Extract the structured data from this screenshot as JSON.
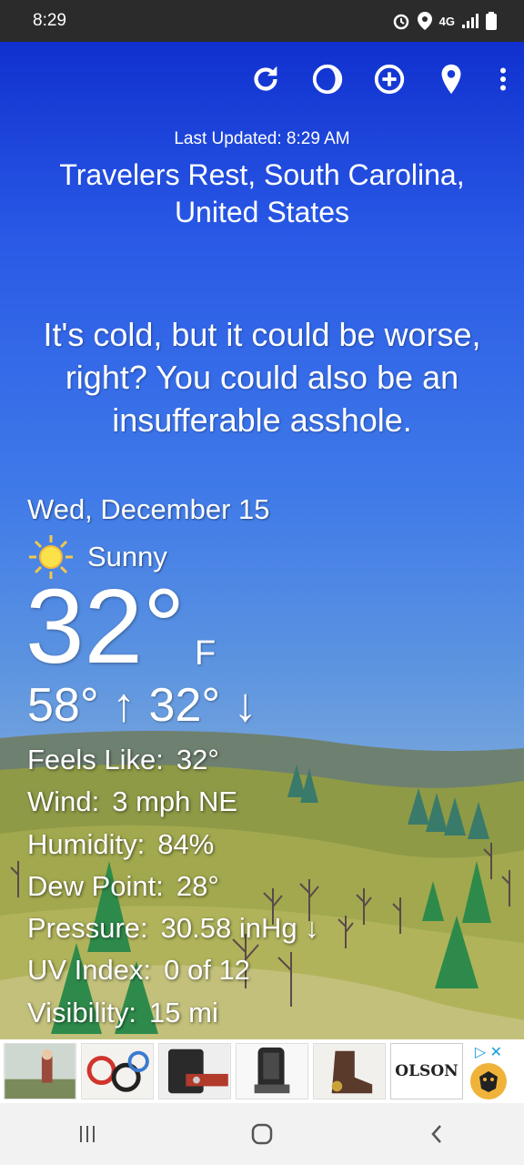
{
  "status_bar": {
    "time": "8:29",
    "network": "4G",
    "icons": [
      "alarm-icon",
      "location-icon",
      "signal-icon",
      "battery-icon"
    ]
  },
  "toolbar": {
    "icons": [
      "refresh-icon",
      "theme-icon",
      "add-location-icon",
      "location-pin-icon",
      "more-vert-icon"
    ]
  },
  "header": {
    "last_updated": "Last Updated: 8:29 AM",
    "location": "Travelers Rest, South Carolina, United States"
  },
  "quote": "It's cold, but it could be worse, right? You could also be an insufferable asshole.",
  "forecast": {
    "date": "Wed, December 15",
    "condition": "Sunny",
    "condition_icon": "sun-icon",
    "temperature": "32°",
    "unit": "F",
    "hi_lo": "58° ↑ 32° ↓"
  },
  "details": [
    {
      "label": "Feels Like:",
      "value": "32°"
    },
    {
      "label": "Wind:",
      "value": "3 mph NE"
    },
    {
      "label": "Humidity:",
      "value": "84%"
    },
    {
      "label": "Dew Point:",
      "value": "28°"
    },
    {
      "label": "Pressure:",
      "value": "30.58 inHg ↓"
    },
    {
      "label": "UV Index:",
      "value": "0 of 12"
    },
    {
      "label": "Visibility:",
      "value": "15 mi"
    }
  ],
  "ad": {
    "brand": "OLSON",
    "badge": "▷ ✕",
    "thumbs": [
      "ad-photo-1",
      "ad-photo-2",
      "ad-photo-3",
      "ad-photo-4",
      "ad-photo-5"
    ]
  },
  "nav_bar": {
    "icons": [
      "recents-icon",
      "home-icon",
      "back-icon"
    ]
  },
  "colors": {
    "sky_top": "#1030cf",
    "sky_mid": "#3f7ae9",
    "hills": "#8e9a46",
    "trees": "#3a7a5a"
  }
}
